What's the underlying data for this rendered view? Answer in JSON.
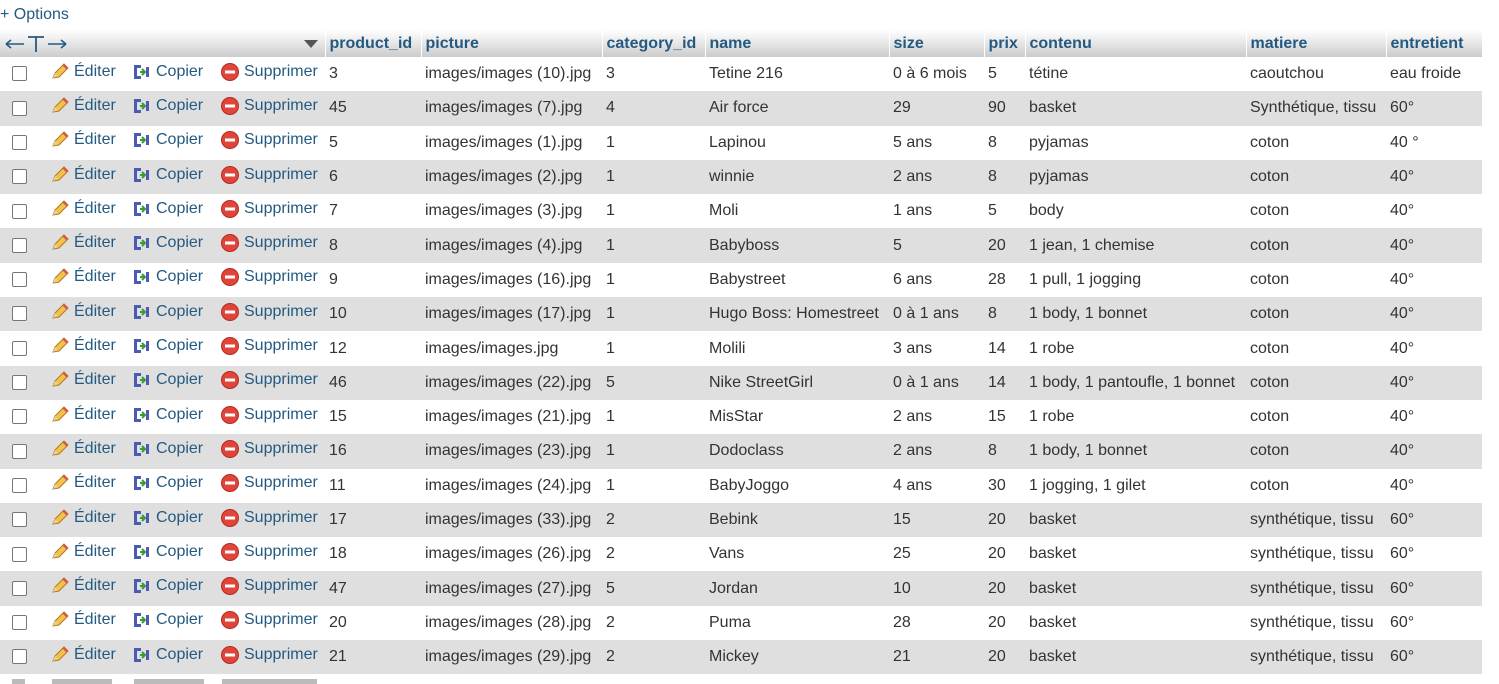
{
  "options_label": "+ Options",
  "header": {
    "columns": [
      "product_id",
      "picture",
      "category_id",
      "name",
      "size",
      "prix",
      "contenu",
      "matiere",
      "entretient"
    ]
  },
  "actions": {
    "edit": "Éditer",
    "copy": "Copier",
    "delete": "Supprimer"
  },
  "rows": [
    [
      "3",
      "images/images (10).jpg",
      "3",
      "Tetine 216",
      "0 à 6 mois",
      "5",
      "tétine",
      "caoutchou",
      "eau froide"
    ],
    [
      "45",
      "images/images (7).jpg",
      "4",
      "Air force",
      "29",
      "90",
      "basket",
      "Synthétique, tissu",
      "60°"
    ],
    [
      "5",
      "images/images (1).jpg",
      "1",
      "Lapinou",
      "5 ans",
      "8",
      "pyjamas",
      "coton",
      "40 °"
    ],
    [
      "6",
      "images/images (2).jpg",
      "1",
      "winnie",
      "2 ans",
      "8",
      "pyjamas",
      "coton",
      "40°"
    ],
    [
      "7",
      "images/images (3).jpg",
      "1",
      "Moli",
      "1 ans",
      "5",
      "body",
      "coton",
      "40°"
    ],
    [
      "8",
      "images/images (4).jpg",
      "1",
      "Babyboss",
      "5",
      "20",
      "1 jean, 1 chemise",
      "coton",
      "40°"
    ],
    [
      "9",
      "images/images (16).jpg",
      "1",
      "Babystreet",
      "6 ans",
      "28",
      "1 pull, 1 jogging",
      "coton",
      "40°"
    ],
    [
      "10",
      "images/images (17).jpg",
      "1",
      "Hugo Boss: Homestreet",
      "0 à 1 ans",
      "8",
      "1 body, 1 bonnet",
      "coton",
      "40°"
    ],
    [
      "12",
      "images/images.jpg",
      "1",
      "Molili",
      "3 ans",
      "14",
      "1 robe",
      "coton",
      "40°"
    ],
    [
      "46",
      "images/images (22).jpg",
      "5",
      "Nike StreetGirl",
      "0 à 1 ans",
      "14",
      "1 body, 1 pantoufle, 1 bonnet",
      "coton",
      "40°"
    ],
    [
      "15",
      "images/images (21).jpg",
      "1",
      "MisStar",
      "2 ans",
      "15",
      "1 robe",
      "coton",
      "40°"
    ],
    [
      "16",
      "images/images (23).jpg",
      "1",
      "Dodoclass",
      "2 ans",
      "8",
      "1 body, 1 bonnet",
      "coton",
      "40°"
    ],
    [
      "11",
      "images/images (24).jpg",
      "1",
      "BabyJoggo",
      "4 ans",
      "30",
      "1 jogging, 1 gilet",
      "coton",
      "40°"
    ],
    [
      "17",
      "images/images (33).jpg",
      "2",
      "Bebink",
      "15",
      "20",
      "basket",
      "synthétique, tissu",
      "60°"
    ],
    [
      "18",
      "images/images (26).jpg",
      "2",
      "Vans",
      "25",
      "20",
      "basket",
      "synthétique, tissu",
      "60°"
    ],
    [
      "47",
      "images/images (27).jpg",
      "5",
      "Jordan",
      "10",
      "20",
      "basket",
      "synthétique, tissu",
      "60°"
    ],
    [
      "20",
      "images/images (28).jpg",
      "2",
      "Puma",
      "28",
      "20",
      "basket",
      "synthétique, tissu",
      "60°"
    ],
    [
      "21",
      "images/images (29).jpg",
      "2",
      "Mickey",
      "21",
      "20",
      "basket",
      "synthétique, tissu",
      "60°"
    ]
  ],
  "icons": {
    "edit": "pencil-icon",
    "copy": "copy-icon",
    "delete": "delete-icon",
    "sort": "sort-down-icon"
  },
  "colors": {
    "link": "#235a81",
    "row_alt": "#dfdfdf",
    "delete_icon": "#e0453a"
  }
}
